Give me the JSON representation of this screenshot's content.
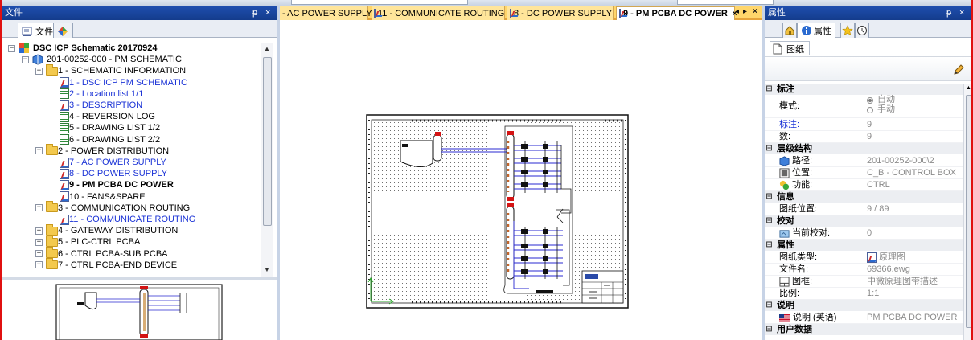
{
  "left_panel": {
    "title": "文件",
    "pin": "ᵽ",
    "close": "×",
    "tab_files": "文件",
    "tree": [
      {
        "label": "DSC ICP Schematic 20170924",
        "level": 0,
        "expander": "−",
        "icon": "project-icon",
        "bold": true
      },
      {
        "label": "201-00252-000 - PM SCHEMATIC",
        "level": 1,
        "expander": "−",
        "icon": "book-icon"
      },
      {
        "label": "1 - SCHEMATIC INFORMATION",
        "level": 2,
        "expander": "−",
        "icon": "folder-icon"
      },
      {
        "label": "1 - DSC ICP PM SCHEMATIC",
        "level": 3,
        "icon": "schematic-sheet-icon",
        "blue": true
      },
      {
        "label": "2 - Location list 1/1",
        "level": 3,
        "icon": "grid-sheet-icon",
        "blue": true
      },
      {
        "label": "3 - DESCRIPTION",
        "level": 3,
        "icon": "schematic-sheet-icon",
        "blue": true
      },
      {
        "label": "4 - REVERSION LOG",
        "level": 3,
        "icon": "grid-sheet-icon"
      },
      {
        "label": "5 - DRAWING LIST 1/2",
        "level": 3,
        "icon": "grid-sheet-icon"
      },
      {
        "label": "6 - DRAWING LIST 2/2",
        "level": 3,
        "icon": "grid-sheet-icon"
      },
      {
        "label": "2 - POWER DISTRIBUTION",
        "level": 2,
        "expander": "−",
        "icon": "folder-icon"
      },
      {
        "label": "7 - AC POWER SUPPLY",
        "level": 3,
        "icon": "schematic-sheet-icon",
        "blue": true
      },
      {
        "label": "8 - DC POWER SUPPLY",
        "level": 3,
        "icon": "schematic-sheet-icon",
        "blue": true
      },
      {
        "label": "9 - PM PCBA DC POWER",
        "level": 3,
        "icon": "schematic-sheet-icon",
        "bold": true
      },
      {
        "label": "10 - FANS&SPARE",
        "level": 3,
        "icon": "schematic-sheet-icon"
      },
      {
        "label": "3 - COMMUNICATION ROUTING",
        "level": 2,
        "expander": "−",
        "icon": "folder-icon"
      },
      {
        "label": "11 - COMMUNICATE ROUTING",
        "level": 3,
        "icon": "schematic-sheet-icon",
        "blue": true
      },
      {
        "label": "4 - GATEWAY DISTRIBUTION",
        "level": 2,
        "expander": "+",
        "icon": "folder-icon"
      },
      {
        "label": "5 - PLC-CTRL PCBA",
        "level": 2,
        "expander": "+",
        "icon": "folder-icon"
      },
      {
        "label": "6 - CTRL PCBA-SUB PCBA",
        "level": 2,
        "expander": "+",
        "icon": "folder-icon"
      },
      {
        "label": "7 - CTRL PCBA-END DEVICE",
        "level": 2,
        "expander": "+",
        "icon": "folder-icon"
      }
    ]
  },
  "doc_tabs": [
    {
      "label": "- AC POWER SUPPLY",
      "icon": false
    },
    {
      "label": "11 - COMMUNICATE ROUTING",
      "icon": true
    },
    {
      "label": "8 - DC POWER SUPPLY",
      "icon": true
    },
    {
      "label": "9 - PM PCBA DC POWER",
      "icon": true,
      "active": true
    }
  ],
  "doc_tab_close": "×",
  "doc_nav": {
    "prev": "◂",
    "next": "▸",
    "close": "×"
  },
  "right_panel": {
    "title": "属性",
    "pin": "ᵽ",
    "close": "×",
    "tab_properties": "属性",
    "sub_tab": "图纸",
    "categories": [
      {
        "label": "标注",
        "rows": [
          {
            "key": "模式:",
            "radio": [
              "自动",
              "手动"
            ],
            "selected": 0
          },
          {
            "key": "标注:",
            "value": "9",
            "blue": true
          },
          {
            "key": "数:",
            "value": "9"
          }
        ]
      },
      {
        "label": "层级结构",
        "rows": [
          {
            "key": "路径:",
            "value": "201-00252-000\\2",
            "icon": "book-icon"
          },
          {
            "key": "位置:",
            "value": "C_B - CONTROL BOX",
            "icon": "location-icon"
          },
          {
            "key": "功能:",
            "value": "CTRL",
            "icon": "function-icon"
          }
        ]
      },
      {
        "label": "信息",
        "rows": [
          {
            "key": "图纸位置:",
            "value": "9 / 89"
          }
        ]
      },
      {
        "label": "校对",
        "rows": [
          {
            "key": "当前校对:",
            "value": "0",
            "icon": "review-icon"
          }
        ]
      },
      {
        "label": "属性",
        "rows": [
          {
            "key": "图纸类型:",
            "value": "原理图",
            "value_icon": true
          },
          {
            "key": "文件名:",
            "value": "69366.ewg"
          },
          {
            "key": "图框:",
            "value": "中微原理图带描述",
            "icon": "frame-icon"
          },
          {
            "key": "比例:",
            "value": "1:1"
          }
        ]
      },
      {
        "label": "说明",
        "rows": [
          {
            "key": "说明 (英语)",
            "value": "PM PCBA DC POWER",
            "icon": "flag-us-icon"
          }
        ]
      },
      {
        "label": "用户数据",
        "rows": []
      }
    ]
  },
  "colors": {
    "header": "#1a47a4",
    "tab_strip": "#ffd66b",
    "link": "#1b33d6",
    "border": "#e01010"
  }
}
